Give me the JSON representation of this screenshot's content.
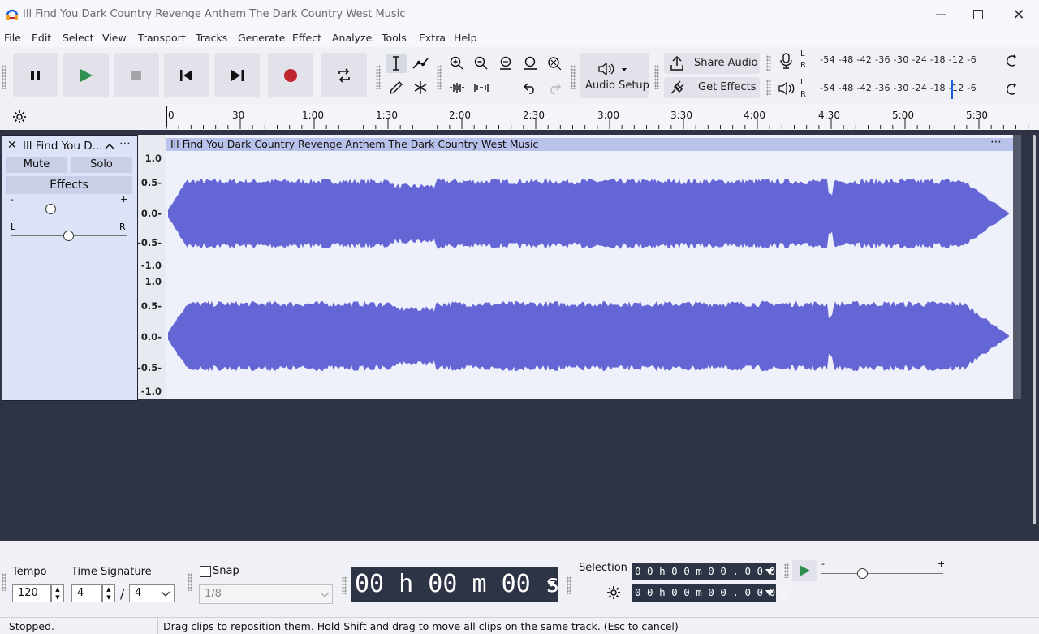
{
  "window": {
    "title": "Ill Find You Dark Country Revenge Anthem The Dark Country West Music"
  },
  "menu": [
    "File",
    "Edit",
    "Select",
    "View",
    "Transport",
    "Tracks",
    "Generate",
    "Effect",
    "Analyze",
    "Tools",
    "Extra",
    "Help"
  ],
  "toolbar": {
    "audio_setup_label": "Audio Setup",
    "share_audio_label": "Share Audio",
    "get_effects_label": "Get Effects",
    "meter_scale": "-54 -48 -42 -36 -30 -24 -18 -12 -6",
    "meter_L": "L",
    "meter_R": "R"
  },
  "ruler": {
    "ticks": [
      "0",
      "30",
      "1:00",
      "1:30",
      "2:00",
      "2:30",
      "3:00",
      "3:30",
      "4:00",
      "4:30",
      "5:00",
      "5:30"
    ]
  },
  "track": {
    "name": "Ill Find You D...",
    "mute_label": "Mute",
    "solo_label": "Solo",
    "effects_label": "Effects",
    "gain_min": "-",
    "gain_max": "+",
    "pan_left": "L",
    "pan_right": "R",
    "clip_title": "Ill Find You Dark Country Revenge Anthem The Dark Country West Music",
    "amp_labels": [
      "1.0",
      "0.5-",
      "0.0-",
      "-0.5-",
      "-1.0"
    ]
  },
  "bottom": {
    "tempo_label": "Tempo",
    "tempo_value": "120",
    "time_signature_label": "Time Signature",
    "ts_numerator": "4",
    "ts_slash": "/",
    "ts_denominator": "4",
    "snap_label": "Snap",
    "snap_value": "1/8",
    "time_display": "00 h 00 m 00 s",
    "selection_label": "Selection",
    "selection_start": "0 0 h 0 0 m 0 0 . 0 0 0 s",
    "selection_end": "0 0 h 0 0 m 0 0 . 0 0 0 s",
    "speed_min": "-",
    "speed_max": "+"
  },
  "status": {
    "state": "Stopped.",
    "message": "Drag clips to reposition them. Hold Shift and drag to move all clips on the same track. (Esc to cancel)"
  },
  "colors": {
    "waveform": "#6466d6",
    "record": "#c0262d",
    "play": "#2f8f4e",
    "accent": "#1c5fd6"
  }
}
